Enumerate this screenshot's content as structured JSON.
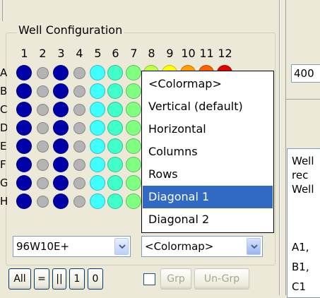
{
  "group": {
    "title": "Well Configuration"
  },
  "columns": [
    "1",
    "2",
    "3",
    "4",
    "5",
    "6",
    "7",
    "8",
    "9",
    "10",
    "11",
    "12"
  ],
  "rows": [
    "A",
    "B",
    "C",
    "D",
    "E",
    "F",
    "G",
    "H"
  ],
  "right_panel": {
    "field_value": "400",
    "text_lines": [
      "Well",
      "rec",
      "Well",
      "",
      "A1,",
      "B1,",
      "C1"
    ]
  },
  "plate_combo": {
    "value": "96W10E+"
  },
  "colormap_combo": {
    "value": "<Colormap>"
  },
  "dropdown": {
    "options": [
      "<Colormap>",
      "Vertical (default)",
      "Horizontal",
      "Columns",
      "Rows",
      "Diagonal 1",
      "Diagonal 2"
    ],
    "selected": "Diagonal 1"
  },
  "buttons": {
    "all": "All",
    "eq": "=",
    "par": "||",
    "one": "1",
    "zero": "0",
    "grp": "Grp",
    "ungrp": "Un-Grp"
  },
  "colors": {
    "blue": "#0000a8",
    "gray": "#b4b4b4",
    "cyan": "#40ffff",
    "aqua_green": "#40ffc8",
    "light_green": "#80ff80",
    "yellow_green": "#c0ff40",
    "yellow": "#ffff00",
    "orange": "#ffa000",
    "red_orange": "#ff6000",
    "red": "#e00000",
    "dark_red": "#c00000",
    "selection": "#316ac5"
  }
}
